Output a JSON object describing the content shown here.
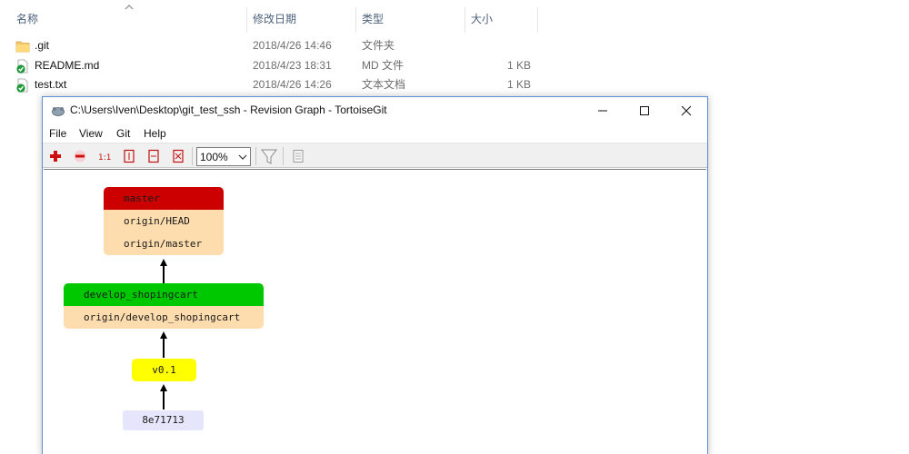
{
  "explorer": {
    "columns": [
      "名称",
      "修改日期",
      "类型",
      "大小"
    ],
    "files": [
      {
        "name": ".git",
        "date": "2018/4/26 14:46",
        "type": "文件夹",
        "size": "",
        "icon": "folder-icon"
      },
      {
        "name": "README.md",
        "date": "2018/4/23 18:31",
        "type": "MD 文件",
        "size": "1 KB",
        "icon": "tortoisegit-ok-icon"
      },
      {
        "name": "test.txt",
        "date": "2018/4/26 14:26",
        "type": "文本文档",
        "size": "1 KB",
        "icon": "tortoisegit-ok-icon"
      }
    ]
  },
  "window": {
    "title": "C:\\Users\\Iven\\Desktop\\git_test_ssh - Revision Graph - TortoiseGit",
    "menu": [
      "File",
      "View",
      "Git",
      "Help"
    ],
    "toolbar": {
      "zoom_value": "100%",
      "icons": [
        "zoom-in-icon",
        "zoom-out-icon",
        "zoom-100-icon",
        "zoom-height-icon",
        "zoom-width-icon",
        "zoom-fit-icon",
        "filter-icon",
        "legend-icon"
      ]
    }
  },
  "graph": {
    "master_node": {
      "head": "master",
      "refs": [
        "origin/HEAD",
        "origin/master"
      ]
    },
    "develop_node": {
      "branch": "develop_shopingcart",
      "refs": [
        "origin/develop_shopingcart"
      ]
    },
    "tag_node": {
      "tag": "v0.1"
    },
    "commit_node": {
      "hash": "8e71713"
    },
    "colors": {
      "head": "#cc0000",
      "branch": "#00c800",
      "remote": "#fddcae",
      "tag": "#ffff00",
      "commit": "#e5e6fb"
    }
  }
}
